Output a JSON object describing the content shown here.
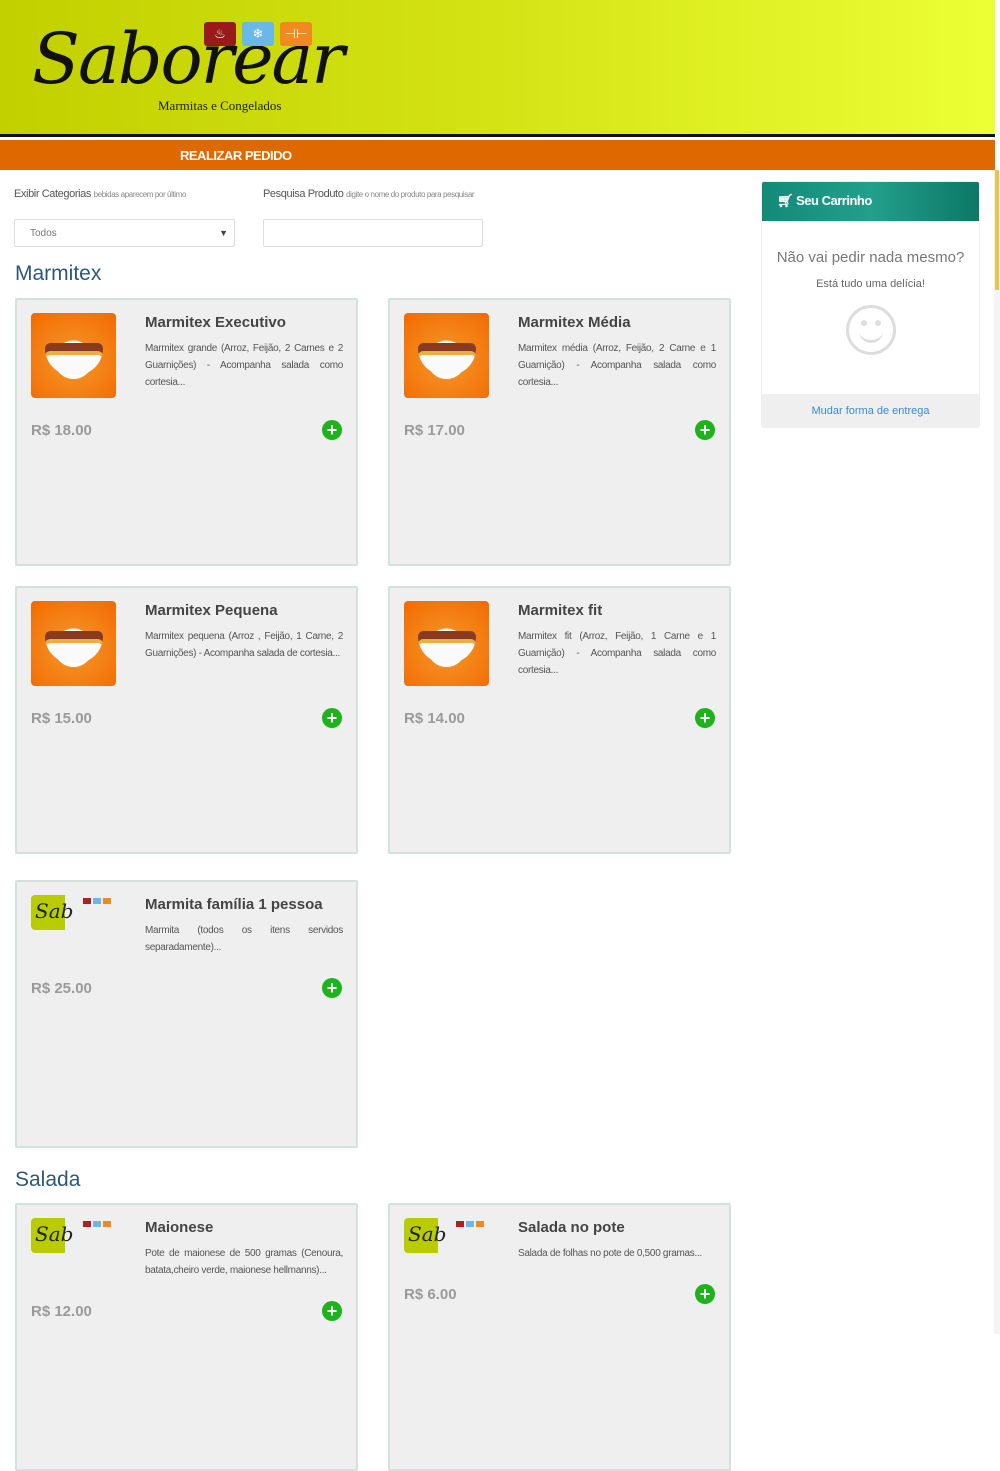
{
  "brand": {
    "name": "Saborear",
    "tagline": "Marmitas e Congelados"
  },
  "nav": {
    "order": "REALIZAR PEDIDO"
  },
  "filters": {
    "category_label": "Exibir Categorias",
    "category_hint": "bebidas aparecem por último",
    "category_value": "Todos",
    "search_label": "Pesquisa Produto",
    "search_hint": "digite o nome do produto para pesquisar",
    "search_value": ""
  },
  "categories": [
    {
      "name": "Marmitex",
      "items": [
        {
          "title": "Marmitex Executivo",
          "desc": "Marmitex grande (Arroz, Feijão, 2 Carnes e 2 Guarnições) - Acompanha salada como cortesia...",
          "price": "R$ 18.00"
        },
        {
          "title": "Marmitex Média",
          "desc": "Marmitex média (Arroz, Feijão, 2 Carne e 1 Guarnição) - Acompanha salada como cortesia...",
          "price": "R$ 17.00"
        },
        {
          "title": "Marmitex Pequena",
          "desc": "Marmitex pequena (Arroz , Feijão, 1 Carne, 2 Guarnições) - Acompanha salada de cortesia...",
          "price": "R$ 15.00"
        },
        {
          "title": "Marmitex fit",
          "desc": "Marmitex fit (Arroz, Feijão, 1 Carne e 1 Guarnição) - Acompanha salada como cortesia...",
          "price": "R$ 14.00"
        },
        {
          "title": "Marmita família 1 pessoa",
          "desc": "Marmita (todos os itens servidos separadamente)...",
          "price": "R$ 25.00"
        }
      ]
    },
    {
      "name": "Salada",
      "items": [
        {
          "title": "Maionese",
          "desc": "Pote de maionese de 500 gramas (Cenoura, batata,cheiro verde, maionese hellmanns)...",
          "price": "R$ 12.00"
        },
        {
          "title": "Salada no pote",
          "desc": "Salada de folhas no pote de 0,500 gramas...",
          "price": "R$ 6.00"
        }
      ]
    }
  ],
  "cart": {
    "title": "Seu Carrinho",
    "empty": "Não vai pedir nada mesmo?",
    "sub": "Está tudo uma delícia!",
    "link": "Mudar forma de entrega"
  },
  "colors": {
    "nav": "#e06800",
    "cart_header": "#128a78",
    "add": "#1db31d",
    "heading": "#2e5878"
  }
}
